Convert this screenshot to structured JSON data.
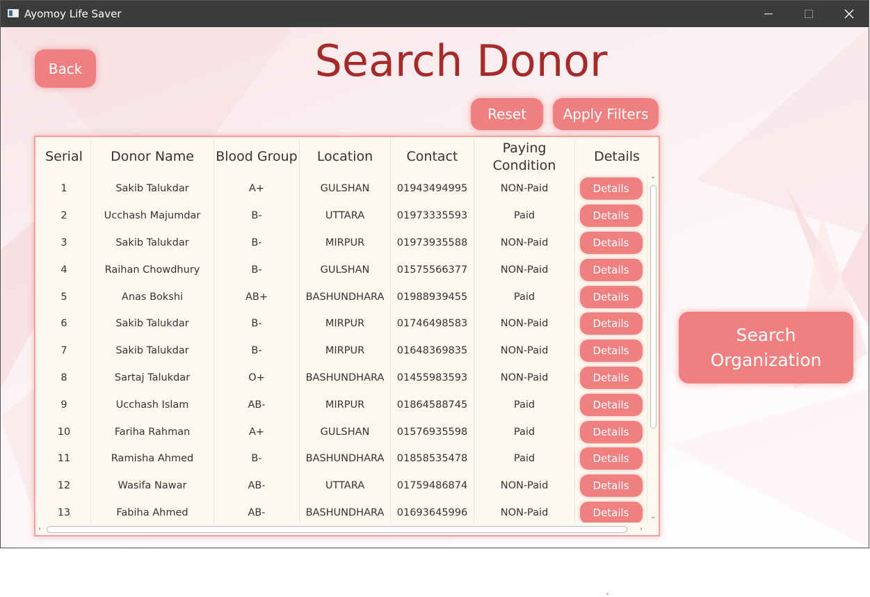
{
  "window": {
    "title": "Ayomoy Life Saver"
  },
  "page": {
    "title": "Search Donor"
  },
  "buttons": {
    "back": "Back",
    "reset": "Reset",
    "apply_filters": "Apply Filters",
    "search_organization": "Search Organization"
  },
  "theme": {
    "accent": "#f08080",
    "title_color": "#a52a2a",
    "table_bg": "#fdf8ef"
  },
  "table": {
    "columns": [
      "Serial",
      "Donor Name",
      "Blood Group",
      "Location",
      "Contact",
      "Paying Condition",
      "Details"
    ],
    "rows": [
      {
        "serial": "1",
        "name": "Sakib Talukdar",
        "blood": "A+",
        "location": "GULSHAN",
        "contact": "01943494995",
        "paying": "NON-Paid",
        "details": "Details"
      },
      {
        "serial": "2",
        "name": "Ucchash Majumdar",
        "blood": "B-",
        "location": "UTTARA",
        "contact": "01973335593",
        "paying": "Paid",
        "details": "Details"
      },
      {
        "serial": "3",
        "name": "Sakib Talukdar",
        "blood": "B-",
        "location": "MIRPUR",
        "contact": "01973935588",
        "paying": "NON-Paid",
        "details": "Details"
      },
      {
        "serial": "4",
        "name": "Raihan Chowdhury",
        "blood": "B-",
        "location": "GULSHAN",
        "contact": "01575566377",
        "paying": "NON-Paid",
        "details": "Details"
      },
      {
        "serial": "5",
        "name": "Anas Bokshi",
        "blood": "AB+",
        "location": "BASHUNDHARA",
        "contact": "01988939455",
        "paying": "Paid",
        "details": "Details"
      },
      {
        "serial": "6",
        "name": "Sakib Talukdar",
        "blood": "B-",
        "location": "MIRPUR",
        "contact": "01746498583",
        "paying": "NON-Paid",
        "details": "Details"
      },
      {
        "serial": "7",
        "name": "Sakib Talukdar",
        "blood": "B-",
        "location": "MIRPUR",
        "contact": "01648369835",
        "paying": "NON-Paid",
        "details": "Details"
      },
      {
        "serial": "8",
        "name": "Sartaj Talukdar",
        "blood": "O+",
        "location": "BASHUNDHARA",
        "contact": "01455983593",
        "paying": "NON-Paid",
        "details": "Details"
      },
      {
        "serial": "9",
        "name": "Ucchash Islam",
        "blood": "AB-",
        "location": "MIRPUR",
        "contact": "01864588745",
        "paying": "Paid",
        "details": "Details"
      },
      {
        "serial": "10",
        "name": "Fariha Rahman",
        "blood": "A+",
        "location": "GULSHAN",
        "contact": "01576935598",
        "paying": "Paid",
        "details": "Details"
      },
      {
        "serial": "11",
        "name": "Ramisha Ahmed",
        "blood": "B-",
        "location": "BASHUNDHARA",
        "contact": "01858535478",
        "paying": "Paid",
        "details": "Details"
      },
      {
        "serial": "12",
        "name": "Wasifa Nawar",
        "blood": "AB-",
        "location": "UTTARA",
        "contact": "01759486874",
        "paying": "NON-Paid",
        "details": "Details"
      },
      {
        "serial": "13",
        "name": "Fabiha Ahmed",
        "blood": "AB-",
        "location": "BASHUNDHARA",
        "contact": "01693645996",
        "paying": "NON-Paid",
        "details": "Details"
      }
    ]
  }
}
